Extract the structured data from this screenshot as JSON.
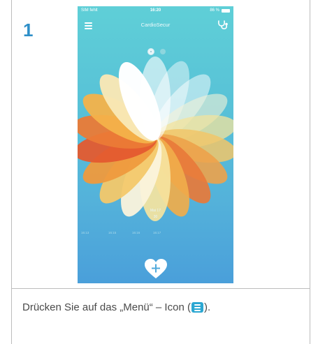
{
  "step": {
    "number": "1"
  },
  "phone": {
    "status": {
      "carrier": "SIM fehlt",
      "time": "16:20",
      "battery": "86 %"
    },
    "nav": {
      "title": "CardioSecur",
      "menu_icon": "hamburger-menu-icon",
      "right_icon": "stethoscope-icon"
    },
    "pager": {
      "pages": 2,
      "active": 1
    },
    "timeline": {
      "date_label": "Mai 17",
      "date_value": "30",
      "times": [
        "16:13",
        "16:15",
        "16:16",
        "16:17"
      ]
    },
    "add_button": {
      "icon": "heart-plus-icon"
    }
  },
  "caption": {
    "before": "Drücken Sie auf das „Menü“ – Icon (",
    "after": ")."
  },
  "colors": {
    "step_number": "#2e8fc8",
    "phone_bg_top": "#5fcfd7",
    "phone_bg_bottom": "#4a9fda",
    "menu_icon_badge": "#2ba7d2",
    "caption_text": "#4a4a4a"
  }
}
